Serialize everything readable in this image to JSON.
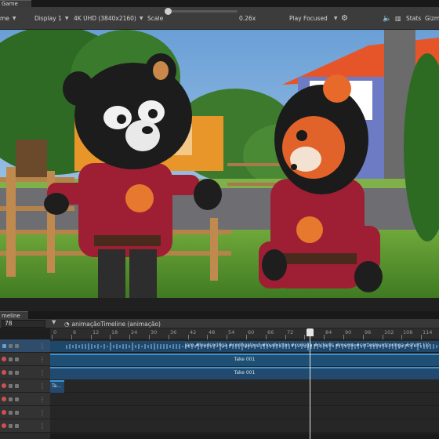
{
  "window": {
    "tab_label": "Game"
  },
  "toolbar": {
    "mode_label": "me",
    "display_label": "Display 1",
    "resolution_label": "4K UHD (3840x2160)",
    "scale_label": "Scale",
    "scale_value": "0.26x",
    "play_mode_label": "Play Focused",
    "stats_label": "Stats",
    "gizmos_label": "Gizmo"
  },
  "timeline": {
    "tab_label": "meline",
    "current_frame": "78",
    "asset_label": "animaçãoTimeline (animação)",
    "ruler_ticks": [
      "0",
      "6",
      "12",
      "18",
      "24",
      "30",
      "36",
      "42",
      "48",
      "54",
      "60",
      "66",
      "72",
      "78",
      "84",
      "90",
      "96",
      "102",
      "108",
      "114"
    ],
    "tracks": [
      {
        "type": "audio",
        "clip_label": "jaro #loudcoringa #coringaloud #loudvictor #coringa #oclenis #meme #corteslourdcoringa #short (1)"
      },
      {
        "type": "animation",
        "clip_label": "Take 001"
      },
      {
        "type": "animation",
        "clip_label": "Take 001"
      },
      {
        "type": "animation",
        "clip_label": "Ta..."
      },
      {
        "type": "empty",
        "clip_label": ""
      },
      {
        "type": "empty",
        "clip_label": ""
      }
    ]
  },
  "colors": {
    "accent": "#3a94d4",
    "record": "#d05050"
  }
}
